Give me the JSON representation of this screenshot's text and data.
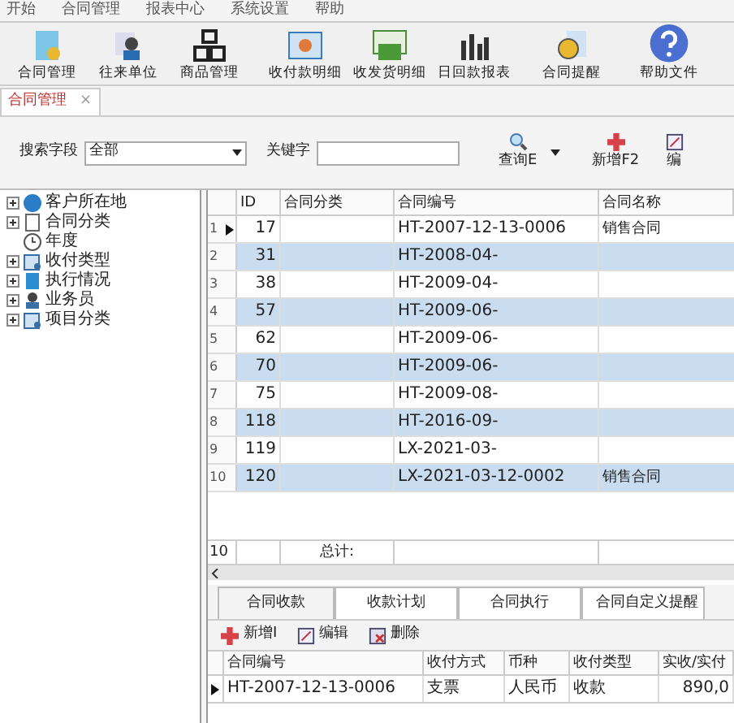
{
  "menu": [
    "开始",
    "合同管理",
    "报表中心",
    "系统设置",
    "帮助"
  ],
  "toolbar": [
    {
      "label": "合同管理",
      "kind": "contract"
    },
    {
      "label": "往来单位",
      "kind": "person"
    },
    {
      "label": "商品管理",
      "kind": "boxes"
    },
    {
      "label": "收付款明细",
      "kind": "sheet"
    },
    {
      "label": "收发货明细",
      "kind": "money"
    },
    {
      "label": "日回款报表",
      "kind": "chart"
    },
    {
      "label": "合同提醒",
      "kind": "clock"
    },
    {
      "label": "帮助文件",
      "kind": "help"
    }
  ],
  "doc_tab": {
    "label": "合同管理",
    "close": "×"
  },
  "search": {
    "field_label": "搜索字段",
    "field_value": "全部",
    "keyword_label": "关键字",
    "query_button": "查询E",
    "add_button": "新增F2",
    "edit_button": "编"
  },
  "tree": [
    {
      "label": "客户所在地",
      "kind": "globe",
      "expandable": true
    },
    {
      "label": "合同分类",
      "kind": "doc",
      "expandable": true
    },
    {
      "label": "年度",
      "kind": "clock",
      "expandable": false
    },
    {
      "label": "收付类型",
      "kind": "card",
      "expandable": true
    },
    {
      "label": "执行情况",
      "kind": "book",
      "expandable": true
    },
    {
      "label": "业务员",
      "kind": "person",
      "expandable": true
    },
    {
      "label": "项目分类",
      "kind": "card",
      "expandable": true
    }
  ],
  "table": {
    "columns": [
      "ID",
      "合同分类",
      "合同编号",
      "合同名称"
    ],
    "rows": [
      {
        "num": "1",
        "id": "17",
        "code": "HT-2007-12-13-0006",
        "name": "销售合同",
        "selected": false,
        "current": true
      },
      {
        "num": "2",
        "id": "31",
        "code": "HT-2008-04-",
        "selected": true,
        "current": false
      },
      {
        "num": "3",
        "id": "38",
        "code": "HT-2009-04-",
        "selected": false,
        "current": false
      },
      {
        "num": "4",
        "id": "57",
        "code": "HT-2009-06-",
        "selected": true,
        "current": false
      },
      {
        "num": "5",
        "id": "62",
        "code": "HT-2009-06-",
        "selected": false,
        "current": false
      },
      {
        "num": "6",
        "id": "70",
        "code": "HT-2009-06-",
        "selected": true,
        "current": false
      },
      {
        "num": "7",
        "id": "75",
        "code": "HT-2009-08-",
        "selected": false,
        "current": false
      },
      {
        "num": "8",
        "id": "118",
        "code": "HT-2016-09-",
        "selected": true,
        "current": false
      },
      {
        "num": "9",
        "id": "119",
        "code": "LX-2021-03-",
        "selected": false,
        "current": false
      },
      {
        "num": "10",
        "id": "120",
        "code": "LX-2021-03-12-0002",
        "name": "销售合同",
        "selected": true,
        "current": false
      }
    ],
    "footer": {
      "count": "10",
      "total_label": "总计:"
    }
  },
  "bottom_tabs": [
    {
      "label": "合同收款",
      "selected": true
    },
    {
      "label": "收款计划",
      "selected": false
    },
    {
      "label": "合同执行",
      "selected": false
    },
    {
      "label": "合同自定义提醒",
      "selected": false
    }
  ],
  "bottom_actions": [
    {
      "label": "新增I",
      "kind": "add"
    },
    {
      "label": "编辑",
      "kind": "edit"
    },
    {
      "label": "删除",
      "kind": "delete"
    }
  ],
  "sub_table": {
    "columns": [
      "合同编号",
      "收付方式",
      "币种",
      "收付类型",
      "实收/实付"
    ],
    "rows": [
      {
        "cells": [
          "HT-2007-12-13-0006",
          "支票",
          "人民币",
          "收款",
          "890,0"
        ],
        "current": true
      }
    ]
  }
}
